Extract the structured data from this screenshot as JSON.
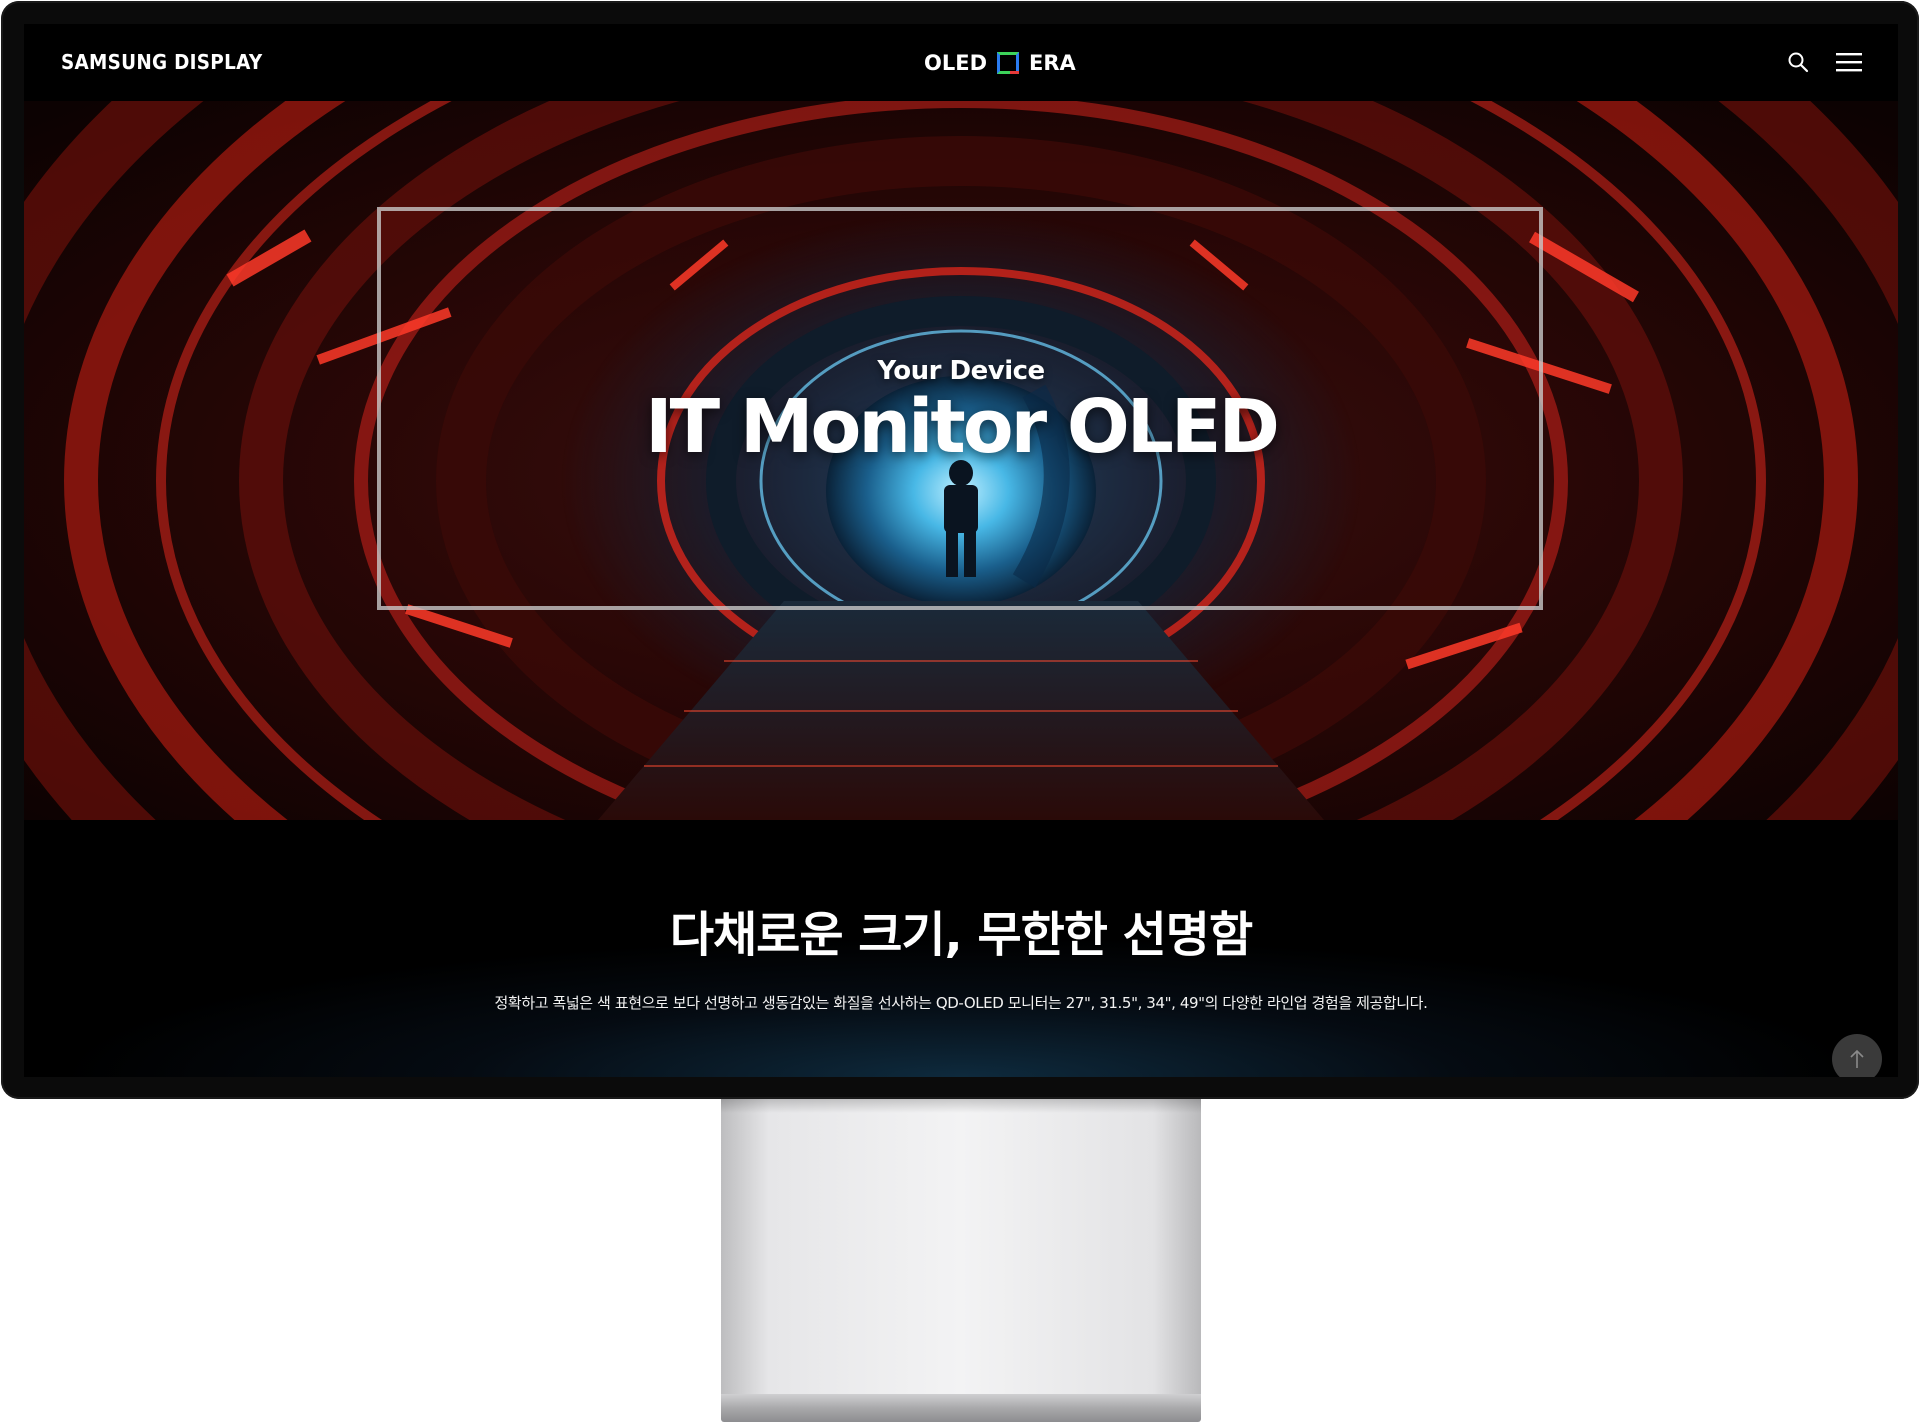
{
  "header": {
    "brand": "SAMSUNG DISPLAY",
    "center_logo_left": "OLED",
    "center_logo_right": "ERA",
    "search_icon": "search-icon",
    "menu_icon": "hamburger-menu-icon"
  },
  "hero": {
    "eyebrow": "Your Device",
    "title": "IT Monitor OLED",
    "accent_color": "#e0281e"
  },
  "info": {
    "heading": "다채로운 크기, 무한한 선명함",
    "description": "정확하고 폭넓은 색 표현으로 보다 선명하고 생동감있는 화질을 선사하는 QD-OLED 모니터는 27\", 31.5\", 34\", 49\"의 다양한 라인업 경험을 제공합니다."
  },
  "controls": {
    "scroll_top_icon": "arrow-up-icon"
  }
}
